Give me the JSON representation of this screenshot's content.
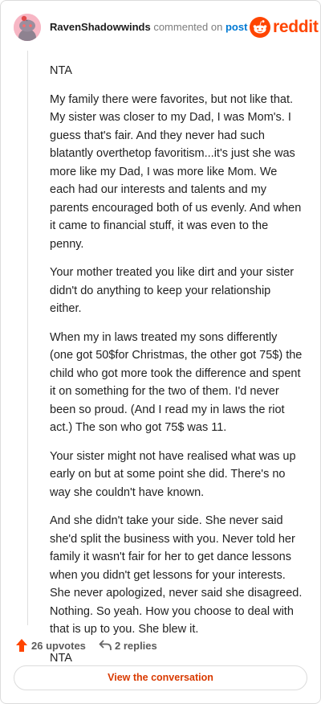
{
  "header": {
    "username": "RavenShadowwinds",
    "action": "commented on",
    "post_link": "post",
    "brand_name": "reddit",
    "avatar_icon": "snoo-avatar-icon",
    "brand_color": "#ff4500"
  },
  "comment": {
    "paragraphs": [
      "NTA",
      "My family there were favorites, but not like that. My sister was closer to my Dad, I was Mom's. I guess that's fair. And they never had such blatantly overthetop favoritism...it's just she was more like my Dad, I was more like Mom. We each had our interests and talents and my parents encouraged both of us evenly. And when it came to financial stuff, it was even to the penny.",
      "Your mother treated you like dirt and your sister didn't do anything to keep your relationship either.",
      "When my in laws treated my sons differently (one got 50$for Christmas, the other got 75$) the child who got more took the difference and spent it on something for the two of them. I'd never been so proud. (And I read my in laws the riot act.) The son who got 75$ was 11.",
      "Your sister might not have realised what was up early on but at some point she did. There's no way she couldn't have known.",
      "And she didn't take your side. She never said she'd split the business with you. Never told her family it wasn't fair for her to get dance lessons when you didn't get lessons for your interests. She never apologized, never said she disagreed. Nothing. So yeah. How you choose to deal with that is up to you. She blew it.",
      "NTA"
    ]
  },
  "footer": {
    "upvotes": "26 upvotes",
    "replies": "2 replies",
    "upvote_icon": "upvote-arrow-icon",
    "reply_icon": "reply-arrow-icon",
    "view_button": "View the conversation"
  }
}
